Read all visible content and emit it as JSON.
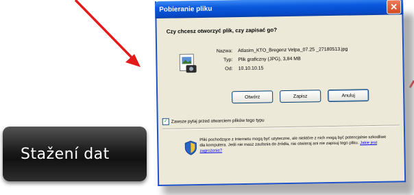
{
  "dialog": {
    "title": "Pobieranie pliku",
    "question": "Czy chcesz otworzyć plik, czy zapisać go?",
    "fields": [
      {
        "label": "Nazwa:",
        "value": "Atlasim_KTO_Bregenz Velpa_07.25 _27180513.jpg"
      },
      {
        "label": "Typ:",
        "value": "Plik graficzny (JPG), 3,84 MB"
      },
      {
        "label": "Od:",
        "value": "10.10.10.15"
      }
    ],
    "buttons": {
      "open": "Otwórz",
      "save": "Zapisz",
      "cancel": "Anuluj"
    },
    "checkbox_label": "Zawsze pytaj przed otwarciem plików tego typu",
    "checkbox_checked": true,
    "warning_text": "Pliki pochodzące z Internetu mogą być użyteczne, ale niektóre z nich mogą być potencjalnie szkodliwe dla komputera. Jeśli nie masz zaufania do źródła, nie otwieraj ani nie zapisuj tego pliku.",
    "warning_link": "Jakie jest zagrożenie?"
  },
  "label": {
    "text": "Stažení dat"
  },
  "colors": {
    "arrow": "#e21a1a",
    "titlebar": "#0a59dd",
    "label_bg": "#1b1b1b"
  },
  "icons": {
    "file": "jpg-file-icon",
    "warning": "shield-warning-icon",
    "close": "close-icon"
  }
}
